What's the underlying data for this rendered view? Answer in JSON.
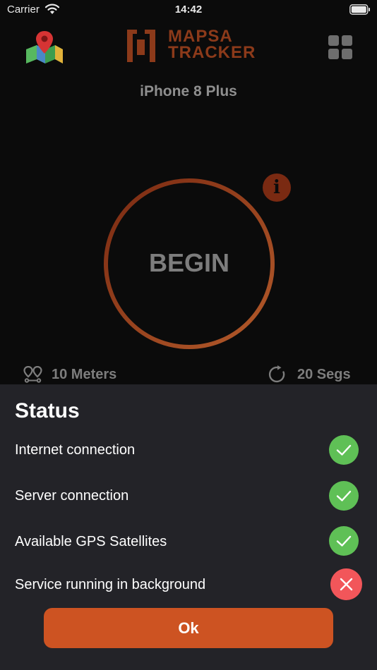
{
  "status_bar": {
    "carrier": "Carrier",
    "time": "14:42"
  },
  "header": {
    "logo_line1": "MAPSA",
    "logo_line2": "TRACKER",
    "device_name": "iPhone 8 Plus"
  },
  "tracker": {
    "begin_label": "BEGIN",
    "info_label": "i",
    "distance": "10 Meters",
    "interval": "20 Segs"
  },
  "status_sheet": {
    "title": "Status",
    "items": [
      {
        "label": "Internet connection",
        "state": "ok"
      },
      {
        "label": "Server connection",
        "state": "ok"
      },
      {
        "label": "Available GPS Satellites",
        "state": "ok"
      },
      {
        "label": "Service running in background",
        "state": "error"
      }
    ],
    "ok_label": "Ok"
  },
  "colors": {
    "accent": "#cd5322",
    "ring_start": "#7a2a12",
    "ring_end": "#b35a2a",
    "success": "#5fc056",
    "error": "#f2565a",
    "sheet_bg": "#232328"
  }
}
